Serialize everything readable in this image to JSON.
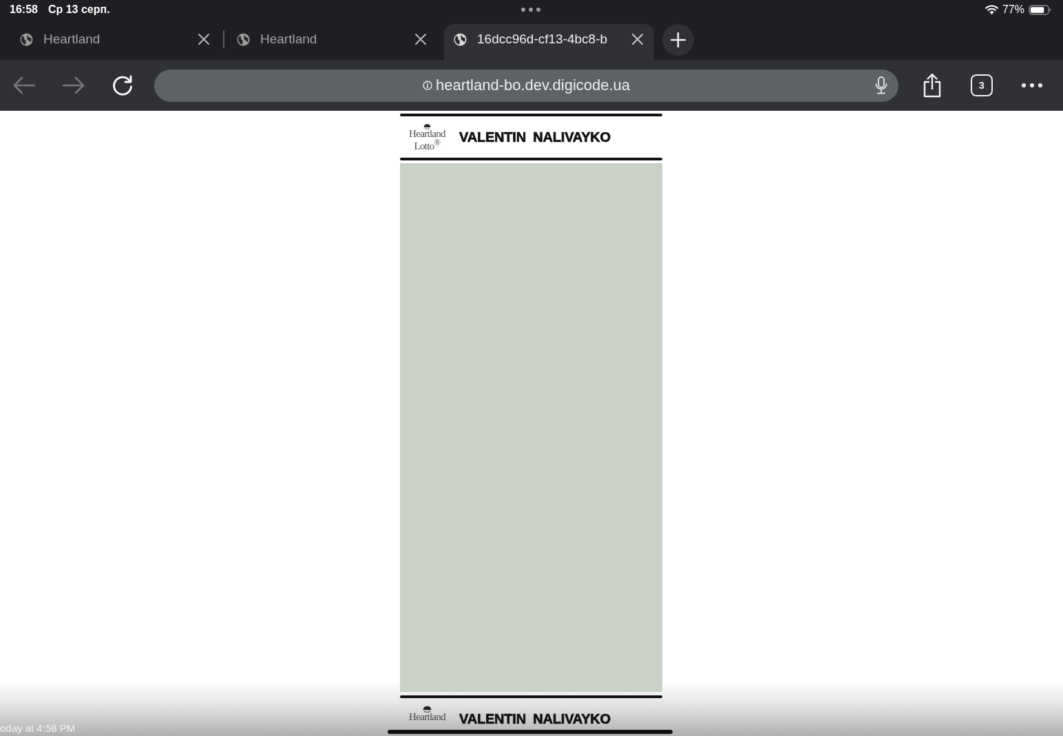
{
  "status_bar": {
    "time": "16:58",
    "date": "Ср 13 серп.",
    "battery_percent": "77%"
  },
  "tabs": [
    {
      "title": "Heartland",
      "selected": false
    },
    {
      "title": "Heartland",
      "selected": false
    },
    {
      "title": "16dcc96d-cf13-4bc8-b",
      "selected": true
    }
  ],
  "toolbar": {
    "nav": [
      {
        "kind": "back",
        "disabled": true
      },
      {
        "kind": "forward",
        "disabled": true
      },
      {
        "kind": "reload",
        "disabled": false
      }
    ],
    "address": "heartland-bo.dev.digicode.ua",
    "tab_count": "3"
  },
  "page": {
    "tickets": [
      {
        "logo_line_1": "Heartland",
        "logo_line_2": "Lotto$^{®}$",
        "name": "VALENTIN NALIVAYKO"
      },
      {
        "logo_line_1": "Heartland",
        "name": "VALENTIN NALIVAYKO"
      }
    ]
  },
  "viewer_caption": "oday at 4:58 PM"
}
